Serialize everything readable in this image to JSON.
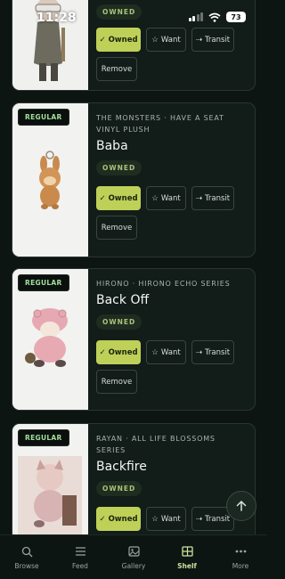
{
  "status_bar": {
    "time": "11:28",
    "battery": "73"
  },
  "cards": [
    {
      "series": "",
      "name": "",
      "status": "OWNED",
      "buttons": {
        "owned": "Owned",
        "want": "Want",
        "transit": "Transit",
        "remove": "Remove"
      }
    },
    {
      "badge": "REGULAR",
      "series": "THE MONSTERS · HAVE A SEAT VINYL PLUSH",
      "name": "Baba",
      "status": "OWNED",
      "buttons": {
        "owned": "Owned",
        "want": "Want",
        "transit": "Transit",
        "remove": "Remove"
      }
    },
    {
      "badge": "REGULAR",
      "series": "HIRONO · HIRONO ECHO SERIES",
      "name": "Back Off",
      "status": "OWNED",
      "buttons": {
        "owned": "Owned",
        "want": "Want",
        "transit": "Transit",
        "remove": "Remove"
      }
    },
    {
      "badge": "REGULAR",
      "series": "RAYAN · ALL LIFE BLOSSOMS SERIES",
      "name": "Backfire",
      "status": "OWNED",
      "buttons": {
        "owned": "Owned",
        "want": "Want",
        "transit": "Transit"
      }
    }
  ],
  "icons": {
    "owned": "✓",
    "want": "☆",
    "transit": "⇢",
    "scroll_top": "arrow-up-icon"
  },
  "tabs": [
    {
      "label": "Browse",
      "icon": "search-icon"
    },
    {
      "label": "Feed",
      "icon": "feed-icon"
    },
    {
      "label": "Gallery",
      "icon": "gallery-icon"
    },
    {
      "label": "Shelf",
      "icon": "shelf-icon",
      "active": true
    },
    {
      "label": "More",
      "icon": "more-icon"
    }
  ],
  "colors": {
    "accent": "#bed058",
    "background": "#0c1512",
    "card": "#121c18",
    "badge_text": "#9fe09a"
  }
}
